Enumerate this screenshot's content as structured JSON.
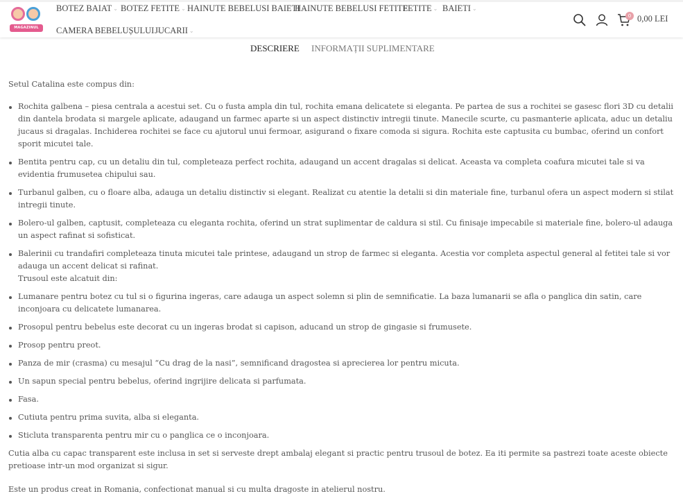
{
  "header": {
    "logo_text": "MAGAZINUL MAMI",
    "nav_row1": [
      {
        "label": "BOTEZ BAIAT"
      },
      {
        "label": "BOTEZ FETITE"
      },
      {
        "label": "HAINUTE BEBELUSI BAIETI"
      },
      {
        "label": "HAINUTE BEBELUSI FETITE"
      },
      {
        "label": "FETITE"
      },
      {
        "label": "BAIETI"
      }
    ],
    "nav_row2": [
      {
        "label": "CAMERA BEBELUȘULUI"
      },
      {
        "label": "JUCARII"
      }
    ],
    "icons": [
      "search-icon",
      "user-icon",
      "cart-icon"
    ],
    "cart_count": "0",
    "cart_total": "0,00 LEI",
    "colors": {
      "cart_badge": "#e8a0a8",
      "logo_badge": "#e45b8e"
    }
  },
  "tabs": [
    {
      "label": "DESCRIERE",
      "active": true
    },
    {
      "label": "INFORMAȚII SUPLIMENTARE",
      "active": false
    }
  ],
  "description": {
    "intro": "Setul Catalina este compus din:",
    "set_items": [
      "Rochita galbena – piesa centrala a acestui set. Cu o fusta ampla din tul, rochita emana delicatete si eleganta. Pe partea de sus a rochitei se gasesc flori 3D cu detalii din dantela brodata si margele aplicate, adaugand un farmec aparte si un aspect distinctiv intregii tinute. Manecile scurte, cu pasmanterie aplicata, aduc un detaliu jucaus si dragalas. Inchiderea rochitei se face cu ajutorul unui fermoar, asigurand o fixare comoda si sigura. Rochita este captusita cu bumbac, oferind un confort sporit micutei tale.",
      "Bentita pentru cap, cu un detaliu din tul, completeaza perfect rochita, adaugand un accent dragalas si delicat. Aceasta va completa coafura micutei tale si va evidentia frumusetea chipului sau.",
      "Turbanul galben, cu o floare alba, adauga un detaliu distinctiv si elegant. Realizat cu atentie la detalii si din materiale fine, turbanul ofera un aspect modern si stilat intregii tinute.",
      "Bolero-ul galben, captusit, completeaza cu eleganta rochita, oferind un strat suplimentar de caldura si stil. Cu finisaje impecabile si materiale fine, bolero-ul adauga un aspect rafinat si sofisticat.",
      "Balerinii cu trandafiri completeaza tinuta micutei tale printese, adaugand un strop de farmec si eleganta. Acestia vor completa aspectul general al fetitei tale si vor adauga un accent delicat si rafinat."
    ],
    "trousseau_intro": "Trusoul este alcatuit din:",
    "trousseau_items": [
      "Lumanare pentru botez cu tul si o figurina ingeras, care adauga un aspect solemn si plin de semnificatie. La baza lumanarii se afla o panglica din satin, care inconjoara cu delicatete lumanarea.",
      "Prosopul pentru bebelus este decorat cu un ingeras brodat si capison, aducand un strop de gingasie si frumusete.",
      "Prosop pentru preot.",
      "Panza de mir (crasma) cu mesajul “Cu drag de la nasi”, semnificand dragostea si aprecierea lor pentru micuta.",
      "Un sapun special pentru bebelus, oferind ingrijire delicata si parfumata.",
      "Fasa.",
      "Cutiuta pentru prima suvita, alba si eleganta.",
      "Sticluta transparenta pentru mir cu o panglica ce o inconjoara."
    ],
    "box_note": "Cutia alba cu capac transparent este inclusa in set si serveste drept ambalaj elegant si practic pentru trusoul de botez. Ea iti permite sa pastrezi toate aceste obiecte pretioase intr-un mod organizat si sigur.",
    "origin_note": "Este un produs creat in Romania, confectionat manual si cu multa dragoste in atelierul nostru."
  }
}
